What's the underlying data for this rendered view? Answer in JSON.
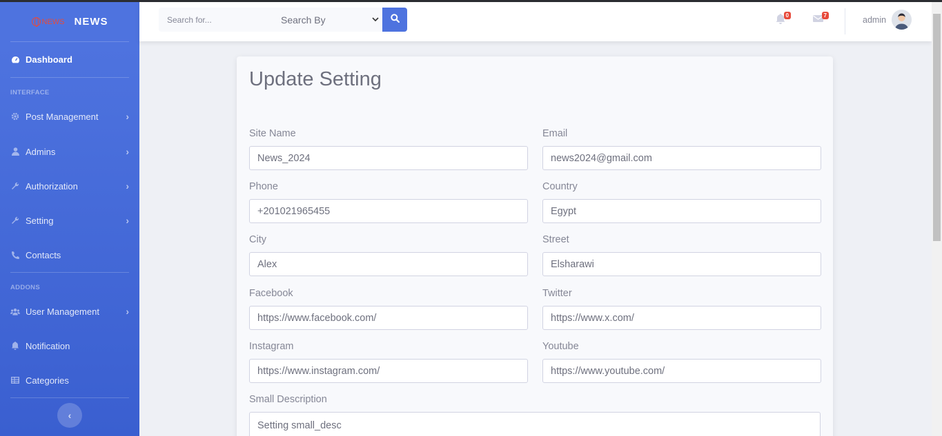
{
  "brand": {
    "logo_text": "NEWS",
    "title": "NEWS"
  },
  "sidebar": {
    "dashboard": "Dashboard",
    "heading_interface": "INTERFACE",
    "heading_addons": "ADDONS",
    "items": [
      {
        "label": "Post Management",
        "icon": "gear-icon"
      },
      {
        "label": "Admins",
        "icon": "user-icon"
      },
      {
        "label": "Authorization",
        "icon": "wrench-icon"
      },
      {
        "label": "Setting",
        "icon": "wrench-icon"
      },
      {
        "label": "Contacts",
        "icon": "phone-icon"
      },
      {
        "label": "User Management",
        "icon": "users-icon"
      },
      {
        "label": "Notification",
        "icon": "bell-icon"
      },
      {
        "label": "Categories",
        "icon": "table-icon"
      }
    ]
  },
  "topbar": {
    "search_placeholder": "Search for...",
    "search_by": "Search By",
    "alerts_count": "0",
    "messages_count": "7",
    "username": "admin"
  },
  "form": {
    "title": "Update Setting",
    "fields": {
      "site_name": {
        "label": "Site Name",
        "value": "News_2024"
      },
      "email": {
        "label": "Email",
        "value": "news2024@gmail.com"
      },
      "phone": {
        "label": "Phone",
        "value": "+201021965455"
      },
      "country": {
        "label": "Country",
        "value": "Egypt"
      },
      "city": {
        "label": "City",
        "value": "Alex"
      },
      "street": {
        "label": "Street",
        "value": "Elsharawi"
      },
      "facebook": {
        "label": "Facebook",
        "value": "https://www.facebook.com/"
      },
      "twitter": {
        "label": "Twitter",
        "value": "https://www.x.com/"
      },
      "instagram": {
        "label": "Instagram",
        "value": "https://www.instagram.com/"
      },
      "youtube": {
        "label": "Youtube",
        "value": "https://www.youtube.com/"
      },
      "small_desc": {
        "label": "Small Description",
        "value": "Setting small_desc"
      }
    }
  },
  "colors": {
    "primary": "#4e73df",
    "danger": "#e74a3b",
    "text": "#858796"
  }
}
